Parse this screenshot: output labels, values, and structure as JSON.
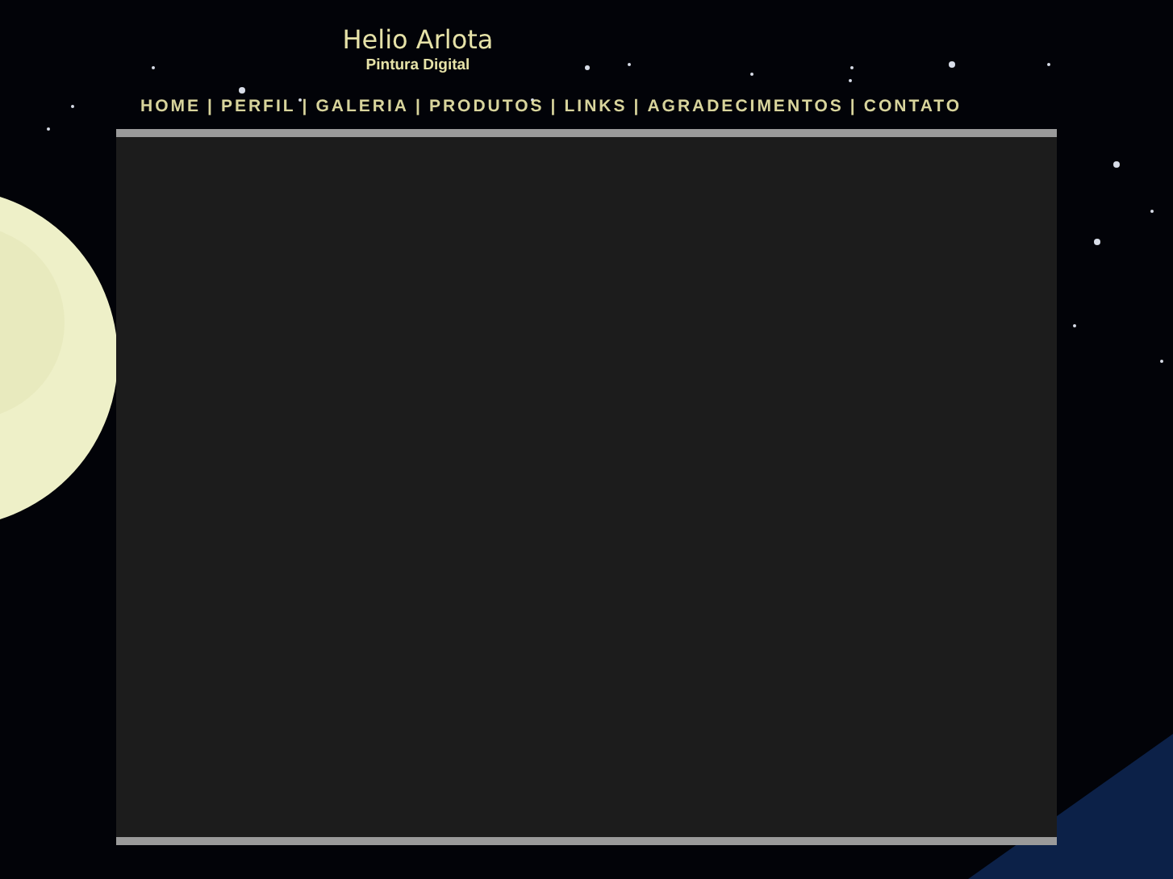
{
  "header": {
    "title": "Helio Arlota",
    "subtitle": "Pintura Digital"
  },
  "nav": {
    "separator": "|",
    "items": [
      {
        "label": "HOME"
      },
      {
        "label": "PERFIL"
      },
      {
        "label": "GALERIA"
      },
      {
        "label": "PRODUTOS"
      },
      {
        "label": "LINKS"
      },
      {
        "label": "AGRADECIMENTOS"
      },
      {
        "label": "CONTATO"
      }
    ]
  }
}
